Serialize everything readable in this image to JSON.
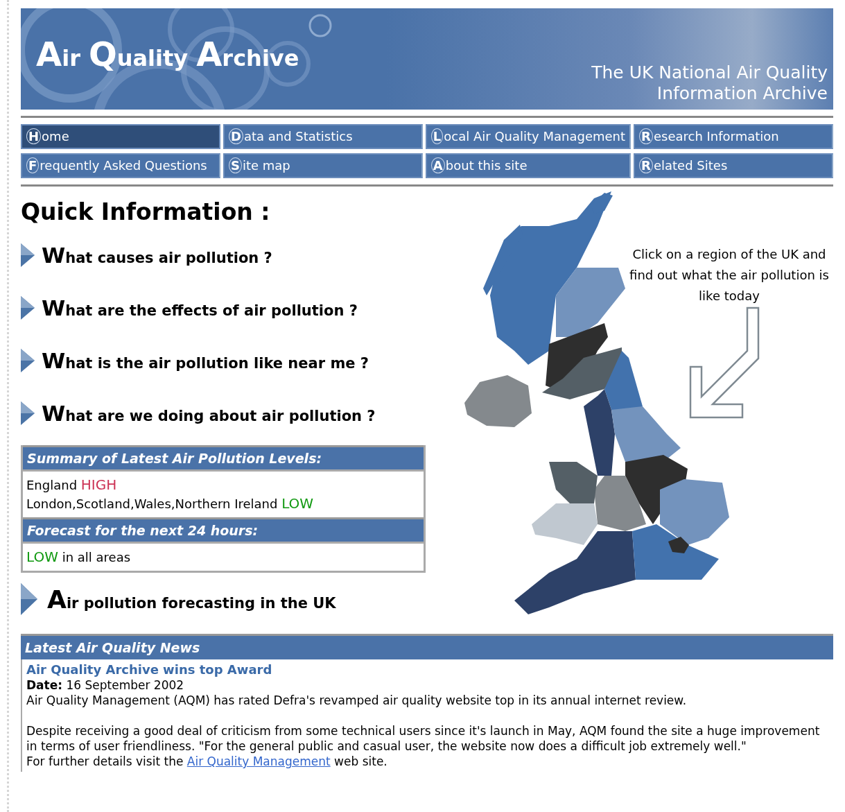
{
  "header": {
    "logo": [
      "Air",
      "Quality",
      "Archive"
    ],
    "tagline": [
      "The UK National Air Quality",
      "Information Archive"
    ]
  },
  "nav": [
    {
      "label": "Home",
      "selected": true
    },
    {
      "label": "Data and Statistics",
      "selected": false
    },
    {
      "label": "Local Air Quality Management",
      "selected": false
    },
    {
      "label": "Research Information",
      "selected": false
    },
    {
      "label": "Frequently Asked Questions",
      "selected": false
    },
    {
      "label": "Site map",
      "selected": false
    },
    {
      "label": "About this site",
      "selected": false
    },
    {
      "label": "Related Sites",
      "selected": false
    }
  ],
  "quick_info": {
    "title": "Quick Information :",
    "questions": [
      "What causes air pollution ?",
      "What are the effects of air pollution ?",
      "What is the air pollution like near me ?",
      "What are we doing about air pollution ?"
    ],
    "summary": {
      "title": "Summary of Latest Air Pollution Levels:",
      "levels": [
        {
          "areas": "England",
          "level": "HIGH",
          "color": "#cc3355"
        },
        {
          "areas": "London,Scotland,Wales,Northern Ireland",
          "level": "LOW",
          "color": "#119911"
        }
      ]
    },
    "forecast": {
      "title": "Forecast for the next 24 hours:",
      "level": "LOW",
      "color": "#119911",
      "text": "in all areas"
    },
    "forecasting_link": "Air pollution forecasting in the UK"
  },
  "map_note": "Click on a region of the UK and find out what the air pollution is like today",
  "news": {
    "title": "Latest Air Quality News",
    "headline": "Air Quality Archive wins top Award",
    "date": "**Date:** 16 September 2002",
    "paragraphs": [
      "Air Quality Management (AQM) has rated Defra's revamped air quality website top in its annual internet review.",
      "Despite receiving a good deal of criticism from some technical users since it's launch in May, AQM found the site a huge improvement in terms of user friendliness. \"For the general public and casual user, the website now does a difficult job extremely well.\""
    ],
    "details": {
      "before": "For further details visit the",
      "link": "Air Quality Management",
      "after": "web site."
    }
  }
}
